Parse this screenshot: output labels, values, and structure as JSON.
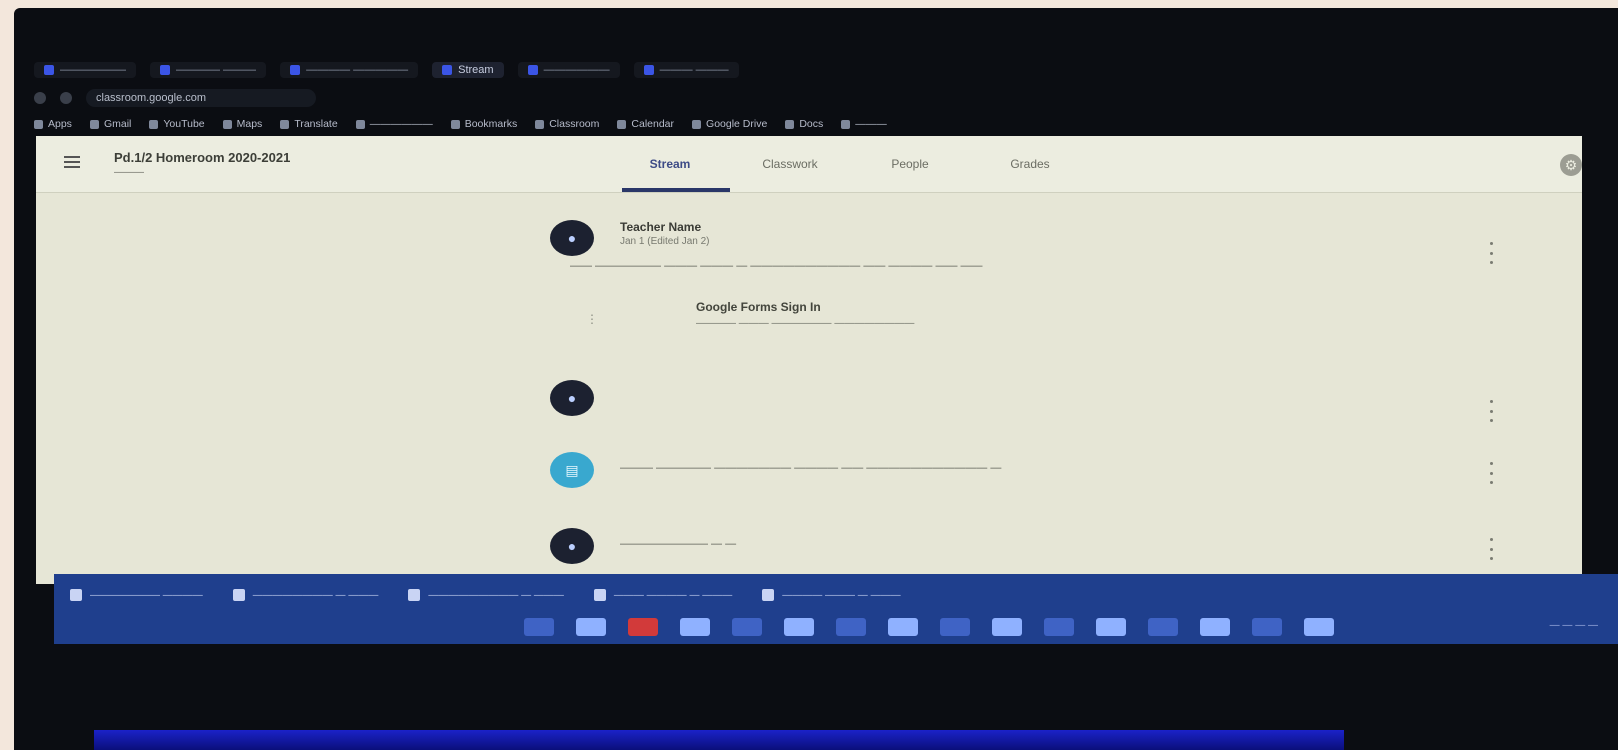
{
  "browser": {
    "tabs": [
      {
        "label": "——————",
        "active": false
      },
      {
        "label": "———— ———",
        "active": false
      },
      {
        "label": "———— —————",
        "active": false
      },
      {
        "label": "Stream",
        "active": true
      },
      {
        "label": "——————",
        "active": false
      },
      {
        "label": "——— ———",
        "active": false
      }
    ],
    "url": "classroom.google.com",
    "bookmarks": [
      "Apps",
      "Gmail",
      "YouTube",
      "Maps",
      "Translate",
      "——————",
      "Bookmarks",
      "Classroom",
      "Calendar",
      "Google Drive",
      "Docs",
      "———"
    ]
  },
  "classroom": {
    "class_name": "Pd.1/2 Homeroom 2020-2021",
    "class_sub": "———",
    "tabs": [
      "Stream",
      "Classwork",
      "People",
      "Grades"
    ],
    "active_tab": "Stream"
  },
  "stream": [
    {
      "author": "Teacher Name",
      "date": "Jan 1 (Edited Jan 2)",
      "body": "—— —————— ——— ——— — —————————— —— ———— —— ——",
      "attachment_title": "Google Forms Sign In",
      "attachment_sub": "———— ——— —————— ————————"
    },
    {
      "author": "",
      "date": "",
      "body": ""
    },
    {
      "text": "——— ————— ——————— ———— —— ——————————— —"
    },
    {
      "text": "———————— — —"
    }
  ],
  "taskbar": {
    "open_windows": [
      "——————— ————",
      "———————— — ———",
      "————————— — ———",
      "——— ———— — ———",
      "———— ——— — ———"
    ],
    "tray_text": "— — — —"
  },
  "colors": {
    "bezel": "#0b0d12",
    "page_bg": "#e6e6d6",
    "accent": "#2a3768",
    "taskbar": "#1f3f8d"
  }
}
